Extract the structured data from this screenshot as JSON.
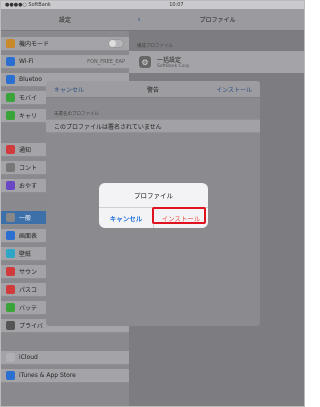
{
  "status_bar": {
    "carrier": "●●●●○ SoftBank",
    "time": "10:07"
  },
  "settings": {
    "title": "設定",
    "rows": [
      {
        "label": "機内モード",
        "color": "#c98a2c",
        "kind": "toggle"
      },
      {
        "label": "Wi-Fi",
        "value": "FON_FREE_EAP",
        "color": "#2b6fd0",
        "kind": "value"
      },
      {
        "label": "Bluetoo",
        "color": "#2b6fd0",
        "kind": "plain"
      },
      {
        "label": "モバイ",
        "color": "#3aa33a",
        "kind": "plain"
      },
      {
        "label": "キャリ",
        "color": "#3aa33a",
        "kind": "plain"
      },
      {
        "label": "通知",
        "color": "#d23b3b",
        "kind": "plain"
      },
      {
        "label": "コント",
        "color": "#777777",
        "kind": "plain"
      },
      {
        "label": "おやす",
        "color": "#6a48c4",
        "kind": "plain"
      },
      {
        "label": "一般",
        "color": "#888888",
        "kind": "selected"
      },
      {
        "label": "画面表",
        "color": "#2b6fd0",
        "kind": "plain"
      },
      {
        "label": "壁紙",
        "color": "#2fa6c8",
        "kind": "plain"
      },
      {
        "label": "サウン",
        "color": "#d23b3b",
        "kind": "plain"
      },
      {
        "label": "パスコ",
        "color": "#d23b3b",
        "kind": "plain"
      },
      {
        "label": "バッテ",
        "color": "#3aa33a",
        "kind": "plain"
      },
      {
        "label": "プライバ",
        "color": "#555555",
        "kind": "plain"
      },
      {
        "label": "iCloud",
        "color": "#b0b0b4",
        "kind": "plain"
      },
      {
        "label": "iTunes & App Store",
        "color": "#2b6fd0",
        "kind": "plain"
      }
    ]
  },
  "profile_pane": {
    "back_label": "‹ 一般",
    "title": "プロファイル",
    "section_header": "構成プロファイル",
    "profile_name": "一括設定",
    "profile_sub": "SoftBank Corp."
  },
  "sheet": {
    "cancel": "キャンセル",
    "title": "警告",
    "install": "インストール",
    "section": "未署名のプロファイル",
    "message": "このプロファイルは署名されていません"
  },
  "alert": {
    "title": "プロファイル",
    "cancel": "キャンセル",
    "install": "インストール"
  }
}
